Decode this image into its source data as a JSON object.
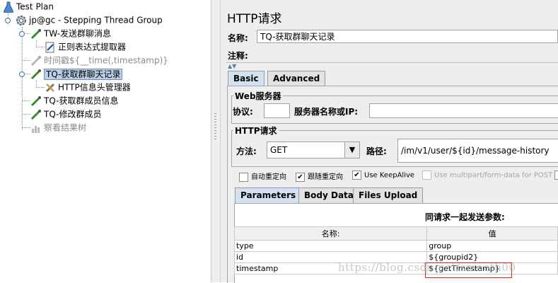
{
  "tree": {
    "root": "Test Plan",
    "thread_group": "jp@gc - Stepping Thread Group",
    "items": [
      {
        "label": "TW-发送群聊消息"
      },
      {
        "label": "正则表达式提取器"
      },
      {
        "label": "时间戳${__time(,timestamp)}"
      },
      {
        "label": "TQ-获取群聊天记录"
      },
      {
        "label": "HTTP信息头管理器"
      },
      {
        "label": "TQ-获取群成员信息"
      },
      {
        "label": "TQ-修改群成员"
      },
      {
        "label": "察看结果树"
      }
    ]
  },
  "form": {
    "title": "HTTP请求",
    "name_label": "名称:",
    "name_value": "TQ-获取群聊天记录",
    "comment_label": "注释:",
    "tabs": [
      "Basic",
      "Advanced"
    ],
    "web_server": {
      "group_title": "Web服务器",
      "protocol_label": "协议:",
      "protocol_value": "",
      "server_label": "服务器名称或IP:",
      "server_value": ""
    },
    "http_request": {
      "group_title": "HTTP请求",
      "method_label": "方法:",
      "method_value": "GET",
      "path_label": "路径:",
      "path_value": "/im/v1/user/${id}/message-history"
    },
    "checkboxes": [
      {
        "label": "自动重定向",
        "checked": false
      },
      {
        "label": "跟随重定向",
        "checked": true
      },
      {
        "label": "Use KeepAlive",
        "checked": true
      },
      {
        "label": "Use multipart/form-data for POST",
        "checked": false
      }
    ],
    "sub_tabs": [
      "Parameters",
      "Body Data",
      "Files Upload"
    ],
    "params": {
      "caption": "同请求一起发送参数:",
      "col_name": "名称:",
      "col_value": "值",
      "rows": [
        {
          "name": "type",
          "value": "group"
        },
        {
          "name": "id",
          "value": "${groupid2}"
        },
        {
          "name": "timestamp",
          "value": "${getTimestamp}"
        }
      ]
    }
  },
  "watermark": "https://blog.csdn.net/smooth00"
}
